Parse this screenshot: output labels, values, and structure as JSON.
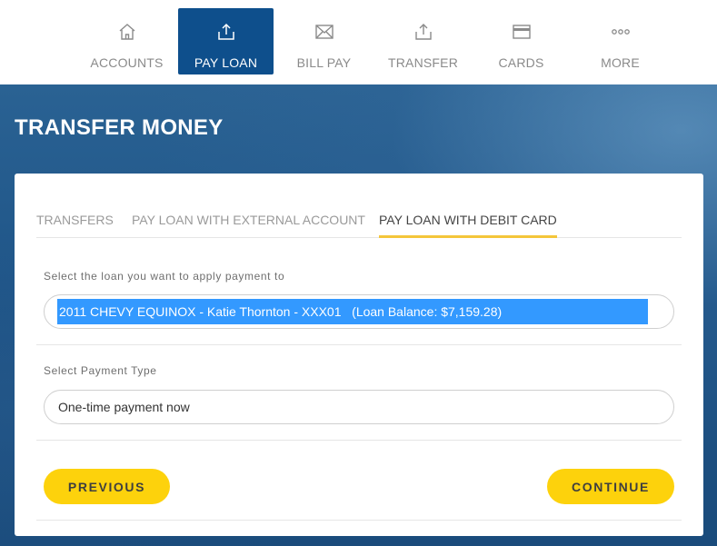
{
  "nav": {
    "items": [
      {
        "label": "ACCOUNTS",
        "icon": "home-icon"
      },
      {
        "label": "PAY LOAN",
        "icon": "upload-icon",
        "active": true
      },
      {
        "label": "BILL PAY",
        "icon": "envelope-icon"
      },
      {
        "label": "TRANSFER",
        "icon": "upload-icon"
      },
      {
        "label": "CARDS",
        "icon": "credit-card-icon"
      },
      {
        "label": "MORE",
        "icon": "more-dots-icon"
      }
    ]
  },
  "page": {
    "title": "TRANSFER MONEY"
  },
  "tabs": [
    {
      "label": "TRANSFERS"
    },
    {
      "label": "PAY LOAN WITH EXTERNAL ACCOUNT"
    },
    {
      "label": "PAY LOAN WITH DEBIT CARD",
      "active": true
    }
  ],
  "form": {
    "loan_label": "Select the loan you want to apply payment to",
    "loan_value": "2011 CHEVY EQUINOX - Katie Thornton - XXX01   (Loan Balance: $7,159.28)",
    "payment_type_label": "Select Payment Type",
    "payment_type_value": "One-time payment now"
  },
  "actions": {
    "previous_label": "PREVIOUS",
    "continue_label": "CONTINUE"
  },
  "colors": {
    "nav_active": "#0e4f8c",
    "accent_yellow": "#fdd20c",
    "tab_underline": "#f4c63a",
    "selection_blue": "#3399ff",
    "hero_blue": "#1f5588"
  }
}
